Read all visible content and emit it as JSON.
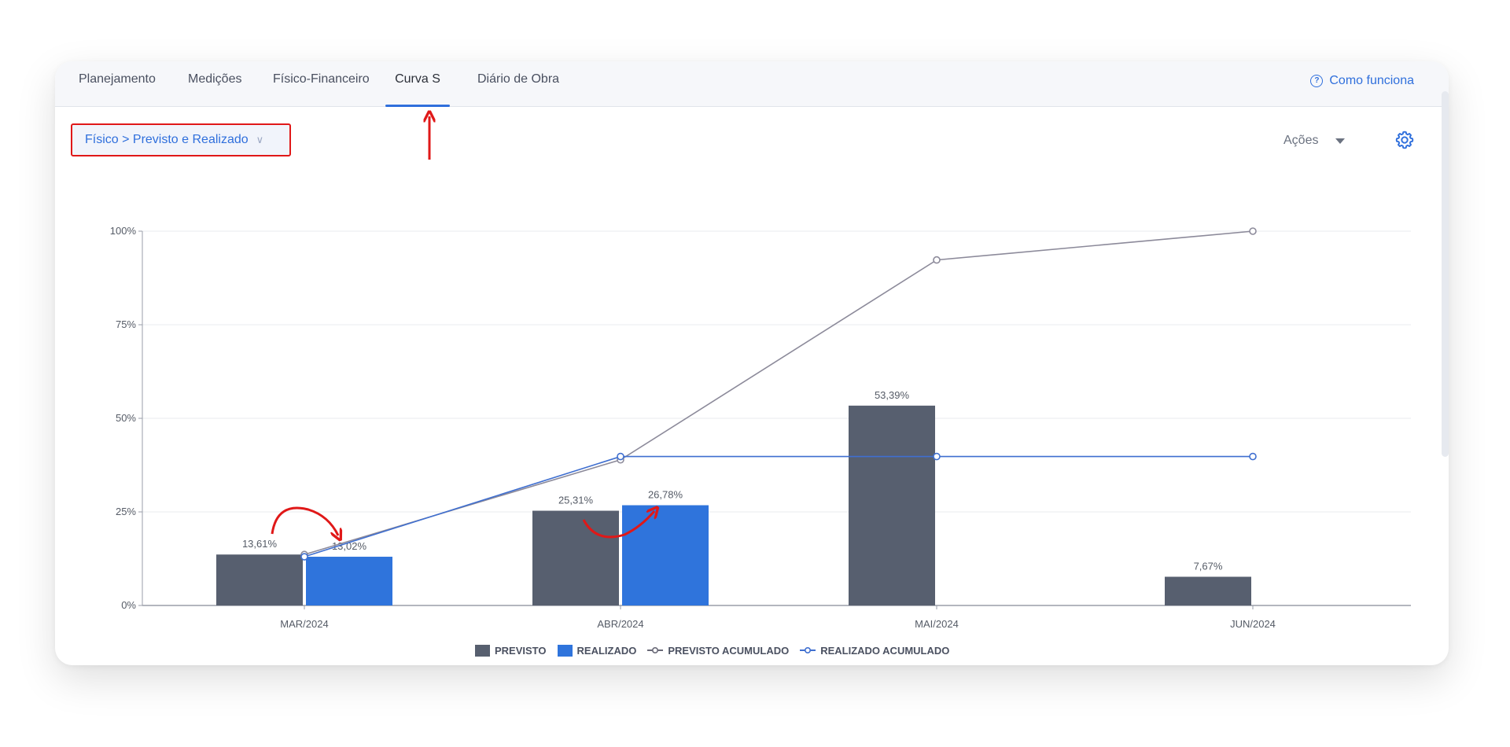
{
  "tabs": [
    {
      "label": "Planejamento",
      "active": false
    },
    {
      "label": "Medições",
      "active": false
    },
    {
      "label": "Físico-Financeiro",
      "active": false
    },
    {
      "label": "Curva S",
      "active": true
    },
    {
      "label": "Diário de Obra",
      "active": false
    }
  ],
  "help_link": {
    "label": "Como funciona",
    "icon": "help-circle-icon"
  },
  "view_selector": {
    "label": "Físico > Previsto e Realizado",
    "icon": "chevron-down-icon"
  },
  "actions_button": {
    "label": "Ações",
    "icon": "caret-down-icon"
  },
  "settings_button": {
    "icon": "gear-icon"
  },
  "colors": {
    "accent": "#2f6fdc",
    "previsto": "#575f6f",
    "realizado": "#2f74dc",
    "previsto_acumulado": "#8c8a9a",
    "realizado_acumulado": "#3f6fd0",
    "annotation": "#e01818"
  },
  "chart_data": {
    "type": "bar",
    "title": "",
    "xlabel": "",
    "ylabel": "",
    "categories": [
      "MAR/2024",
      "ABR/2024",
      "MAI/2024",
      "JUN/2024"
    ],
    "series": [
      {
        "name": "PREVISTO",
        "type": "bar",
        "values": [
          13.61,
          25.31,
          53.39,
          7.67
        ],
        "labels": [
          "13,61%",
          "25,31%",
          "53,39%",
          "7,67%"
        ]
      },
      {
        "name": "REALIZADO",
        "type": "bar",
        "values": [
          13.02,
          26.78,
          null,
          null
        ],
        "labels": [
          "13,02%",
          "26,78%",
          "",
          ""
        ]
      },
      {
        "name": "PREVISTO ACUMULADO",
        "type": "line",
        "values": [
          13.61,
          38.92,
          92.31,
          100
        ]
      },
      {
        "name": "REALIZADO ACUMULADO",
        "type": "line",
        "values": [
          13.02,
          39.8,
          39.8,
          39.8
        ]
      }
    ],
    "ylim": [
      0,
      100
    ],
    "yticks": [
      0,
      25,
      50,
      75,
      100
    ],
    "ytick_labels": [
      "0%",
      "25%",
      "50%",
      "75%",
      "100%"
    ],
    "grid": true,
    "legend_position": "bottom-center"
  }
}
